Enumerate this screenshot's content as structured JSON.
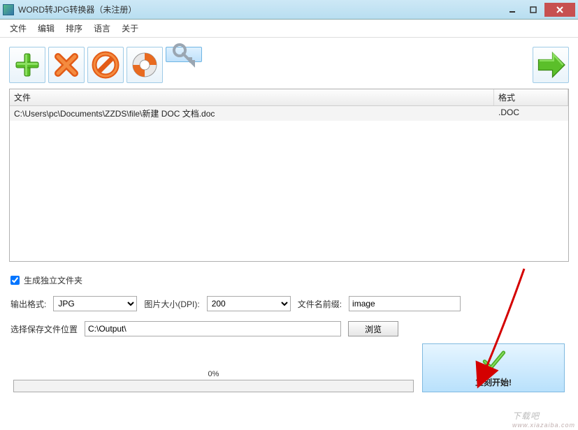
{
  "window": {
    "title": "WORD转JPG转换器（未注册）"
  },
  "menu": {
    "items": [
      "文件",
      "编辑",
      "排序",
      "语言",
      "关于"
    ]
  },
  "toolbar": {
    "add_icon": "add-icon",
    "remove_icon": "remove-icon",
    "clear_icon": "clear-icon",
    "help_icon": "lifebuoy-icon",
    "register_icon": "key-icon",
    "go_icon": "arrow-right-icon"
  },
  "list": {
    "headers": {
      "file": "文件",
      "format": "格式"
    },
    "rows": [
      {
        "file": "C:\\Users\\pc\\Documents\\ZZDS\\file\\新建 DOC 文档.doc",
        "format": ".DOC"
      }
    ]
  },
  "options": {
    "independent_folder_label": "生成独立文件夹",
    "independent_folder_checked": true,
    "output_format_label": "输出格式:",
    "output_format_value": "JPG",
    "dpi_label": "图片大小(DPI):",
    "dpi_value": "200",
    "prefix_label": "文件名前缀:",
    "prefix_value": "image",
    "save_location_label": "选择保存文件位置",
    "save_location_value": "C:\\Output\\",
    "browse_label": "浏览"
  },
  "progress": {
    "text": "0%"
  },
  "start": {
    "label": "立刻开始!"
  },
  "watermark": {
    "main": "下载吧",
    "sub": "www.xiazaiba.com"
  }
}
